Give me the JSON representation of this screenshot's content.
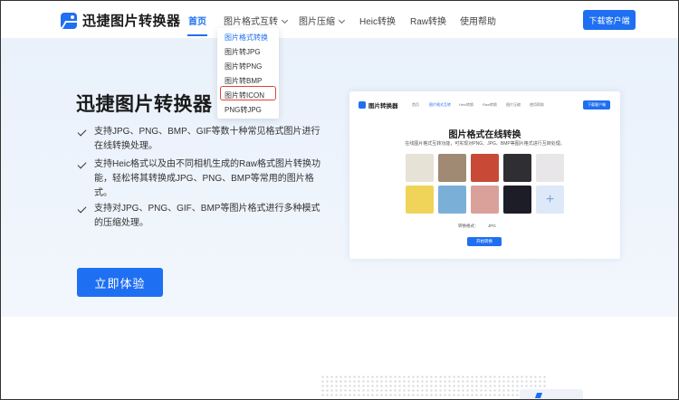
{
  "header": {
    "logo_text": "迅捷图片转换器",
    "nav": [
      {
        "label": "首页",
        "active": true
      },
      {
        "label": "图片格式互转",
        "active": false,
        "has_dropdown": true
      },
      {
        "label": "图片压缩",
        "active": false,
        "has_dropdown": true
      },
      {
        "label": "Heic转换",
        "active": false
      },
      {
        "label": "Raw转换",
        "active": false
      },
      {
        "label": "使用帮助",
        "active": false
      }
    ],
    "download_button": "下载客户端"
  },
  "dropdown": {
    "items": [
      {
        "label": "图片格式转换",
        "selected": true
      },
      {
        "label": "图片转JPG"
      },
      {
        "label": "图片转PNG"
      },
      {
        "label": "图片转BMP"
      },
      {
        "label": "图片转ICON",
        "highlighted": true
      },
      {
        "label": "PNG转JPG"
      }
    ]
  },
  "hero": {
    "title": "迅捷图片转换器",
    "features": [
      [
        "支持JPG、PNG、BMP、GIF等数十种常见格式图片进行",
        "在线转换处理。"
      ],
      [
        "支持Heic格式以及由不同相机生成的Raw格式图片转换功",
        "能，轻松将其转换成JPG、PNG、BMP等常用的图片格",
        "式。"
      ],
      [
        "支持对JPG、PNG、GIF、BMP等图片格式进行多种模式",
        "的压缩处理。"
      ]
    ],
    "cta_button": "立即体验"
  },
  "preview": {
    "logo_text": "图片转换器",
    "nav": [
      "首页",
      "图片格式互转",
      "Heic转换",
      "Raw转换",
      "图片压缩",
      "使用帮助"
    ],
    "download_button": "下载客户端",
    "title": "图片格式在线转换",
    "subtitle": "在线图片格式互转功能，可实现对PNG、JPG、BMP等图片格式进行互转处理。",
    "thumbnails": [
      {
        "color": "#e7e2d6"
      },
      {
        "color": "#a08a73"
      },
      {
        "color": "#c84a36"
      },
      {
        "color": "#2f2f33"
      },
      {
        "color": "#e8e6e9"
      },
      {
        "color": "#f0d45a"
      },
      {
        "color": "#7ab0d8"
      },
      {
        "color": "#d9a19a"
      },
      {
        "color": "#1d1d28"
      }
    ],
    "add_icon": "+",
    "format_label": "转换格式：",
    "format_value": "JPG",
    "start_button": "开始转换"
  },
  "colors": {
    "accent": "#1f6ff2",
    "highlight_border": "#e0423a",
    "hero_bg": "#eaf2fb"
  }
}
